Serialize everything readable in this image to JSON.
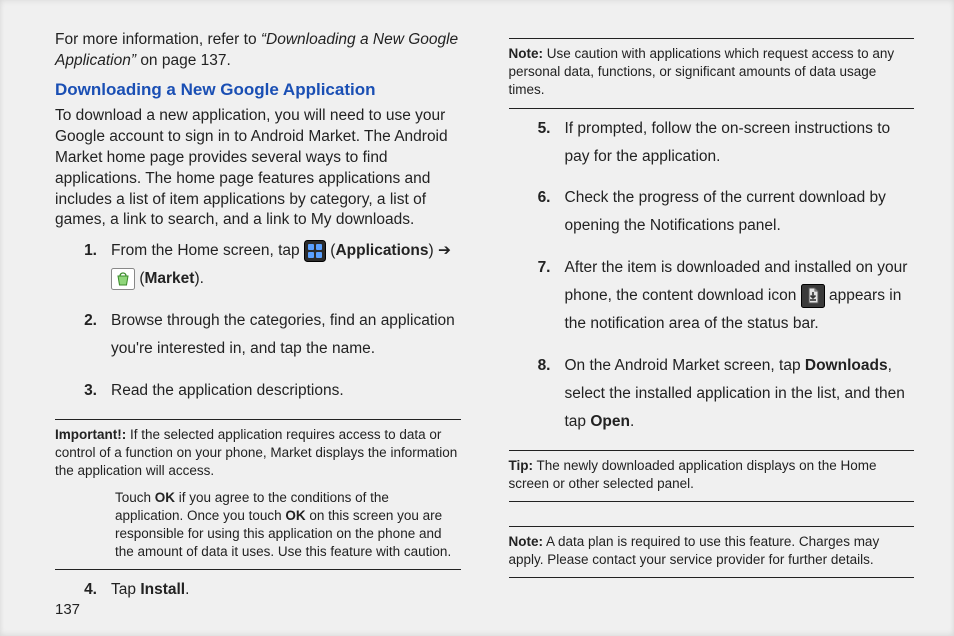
{
  "left": {
    "intro_prefix": "For more information, refer to ",
    "intro_emph": "“Downloading a New Google Application”",
    "intro_suffix": "  on page 137.",
    "heading": "Downloading a New Google Application",
    "lead_para": "To download a new application, you will need to use your Google account to sign in to Android Market. The Android Market home page provides several ways to find applications. The home page features applications and includes a list of item applications by category, a list of games, a link to search, and a link to My downloads.",
    "steps": {
      "s1_num": "1.",
      "s1_a": "From the Home screen, tap ",
      "s1_apps_label": "Applications",
      "s1_arrow": " ➔",
      "s1_market_label": "Market",
      "s1_close": ").",
      "s2_num": "2.",
      "s2": "Browse through the categories, find an application you're interested in, and tap the name.",
      "s3_num": "3.",
      "s3": "Read the application descriptions.",
      "s4_num": "4.",
      "s4_a": "Tap ",
      "s4_b": "Install",
      "s4_c": "."
    },
    "important": {
      "lead": "Important!:",
      "p1_a": " If the selected application requires access to data or control of a function on your phone, Market displays the information the application will access.",
      "p2_a": "Touch ",
      "p2_ok1": "OK",
      "p2_b": " if you agree to the conditions of the application. Once you touch ",
      "p2_ok2": "OK",
      "p2_c": " on this screen you are responsible for using this application on the phone and the amount of data it uses. Use this feature with caution."
    },
    "page_number": "137"
  },
  "right": {
    "note1": {
      "lead": "Note:",
      "text": " Use caution with applications which request access to any personal data, functions, or significant amounts of data usage times."
    },
    "steps": {
      "s5_num": "5.",
      "s5": "If prompted, follow the on-screen instructions to pay for the application.",
      "s6_num": "6.",
      "s6": "Check the progress of the current download by opening the Notifications panel.",
      "s7_num": "7.",
      "s7_a": "After the item is downloaded and installed on your phone, the content download icon ",
      "s7_b": " appears in the notification area of the status bar.",
      "s8_num": "8.",
      "s8_a": "On the Android Market screen, tap ",
      "s8_b": "Downloads",
      "s8_c": ", select the installed application in the list, and then tap ",
      "s8_d": "Open",
      "s8_e": "."
    },
    "tip": {
      "lead": "Tip:",
      "text": " The newly downloaded application displays on the Home screen or other selected panel."
    },
    "note2": {
      "lead": "Note:",
      "text": "  A data plan is required to use this feature. Charges may apply. Please contact your service provider for further details."
    }
  }
}
